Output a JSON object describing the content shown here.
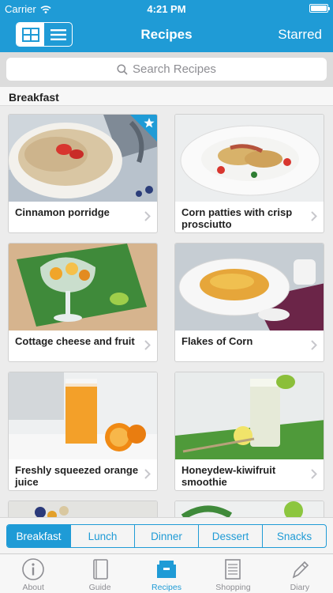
{
  "status": {
    "carrier": "Carrier",
    "time": "4:21 PM"
  },
  "nav": {
    "title": "Recipes",
    "right_button": "Starred"
  },
  "search": {
    "placeholder": "Search Recipes"
  },
  "section": {
    "title": "Breakfast"
  },
  "recipes": [
    {
      "title": "Cinnamon porridge",
      "starred": true,
      "photo": "oatmeal-bowl-with-strawberries"
    },
    {
      "title": "Corn patties with crisp prosciutto",
      "starred": false,
      "photo": "corn-patties-plate"
    },
    {
      "title": "Cottage cheese and fruit",
      "starred": false,
      "photo": "fruit-sundae-glass"
    },
    {
      "title": "Flakes of Corn",
      "starred": false,
      "photo": "cornflakes-bowl"
    },
    {
      "title": "Freshly squeezed orange juice",
      "starred": false,
      "photo": "orange-juice-glass"
    },
    {
      "title": "Honeydew-kiwifruit smoothie",
      "starred": false,
      "photo": "smoothie-glass"
    }
  ],
  "categories": {
    "items": [
      "Breakfast",
      "Lunch",
      "Dinner",
      "Dessert",
      "Snacks"
    ],
    "selected": "Breakfast"
  },
  "tabs": {
    "items": [
      "About",
      "Guide",
      "Recipes",
      "Shopping",
      "Diary"
    ],
    "selected": "Recipes"
  },
  "colors": {
    "accent": "#1f9bd6"
  }
}
